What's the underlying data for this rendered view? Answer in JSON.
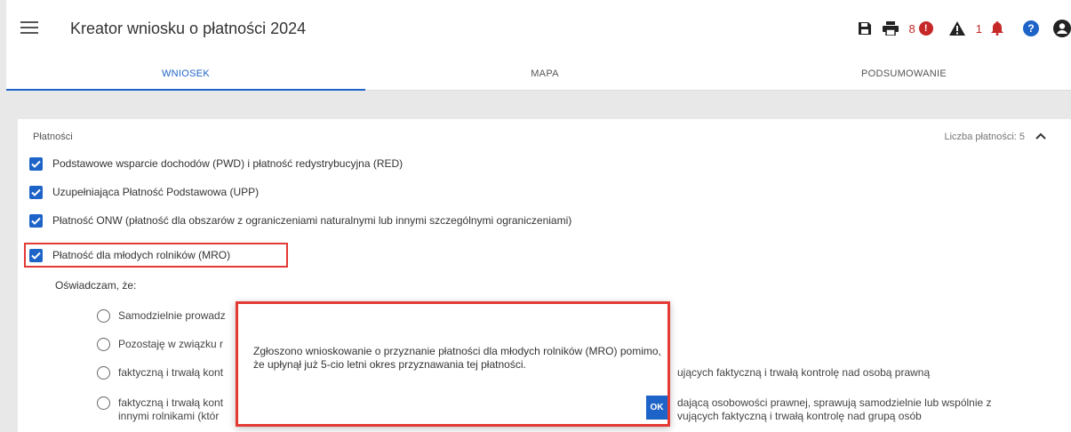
{
  "header": {
    "title": "Kreator wniosku o płatności 2024",
    "error_count": "8",
    "warning_count": "1"
  },
  "tabs": [
    {
      "label": "WNIOSEK",
      "active": true
    },
    {
      "label": "MAPA",
      "active": false
    },
    {
      "label": "PODSUMOWANIE",
      "active": false
    }
  ],
  "payments": {
    "section_title": "Płatności",
    "count_label": "Liczba płatności: 5",
    "items": [
      {
        "label": "Podstawowe wsparcie dochodów (PWD) i płatność redystrybucyjna (RED)",
        "checked": true
      },
      {
        "label": "Uzupełniająca Płatność Podstawowa (UPP)",
        "checked": true
      },
      {
        "label": "Płatność ONW (płatność dla obszarów z ograniczeniami naturalnymi lub innymi szczególnymi ograniczeniami)",
        "checked": true
      },
      {
        "label": "Płatność dla młodych rolników (MRO)",
        "checked": true
      }
    ]
  },
  "declaration": {
    "title": "Oświadczam, że:",
    "options": [
      {
        "text": "Samodzielnie prowadz"
      },
      {
        "text": "Pozostaję w związku r"
      },
      {
        "text": "faktyczną i trwałą kont"
      },
      {
        "text": "faktyczną i trwałą kont",
        "text2": "innymi rolnikami (któr"
      }
    ],
    "right_texts": {
      "line3": "ujących faktyczną i trwałą kontrolę nad osobą prawną",
      "line4a": "dającą osobowości prawnej, sprawują samodzielnie lub wspólnie z",
      "line4b": "vujących faktyczną i trwałą kontrolę nad grupą osób"
    }
  },
  "dialog": {
    "message": "Zgłoszono wnioskowanie o przyznanie płatności dla młodych rolników (MRO) pomimo, że upłynął już 5-cio letni okres przyznawania tej płatności.",
    "ok_label": "OK"
  },
  "colors": {
    "accent": "#1e64c8",
    "error": "#c62828",
    "highlight": "#e53935"
  },
  "icons": [
    "menu-icon",
    "save-icon",
    "print-icon",
    "error-icon",
    "warning-icon",
    "bell-icon",
    "help-icon",
    "user-icon",
    "chevron-up-icon",
    "check-icon"
  ]
}
